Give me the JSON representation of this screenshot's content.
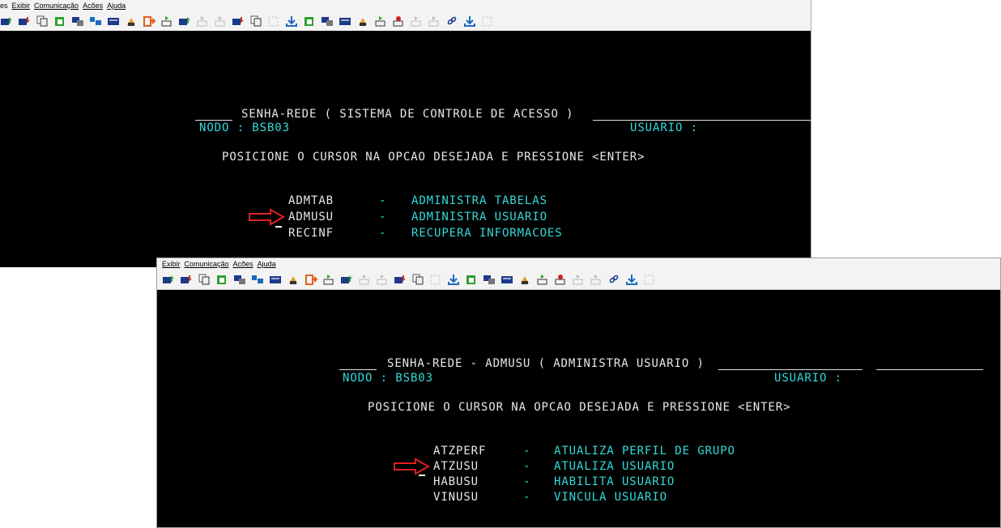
{
  "window1": {
    "menu": [
      "es",
      "Exibir",
      "Comunicação",
      "Acões",
      "Ajuda"
    ],
    "header": {
      "title": "SENHA-REDE ( SISTEMA DE CONTROLE DE ACESSO )",
      "nodo": "NODO : BSB03",
      "usuario": "USUARIO :",
      "instruction": "POSICIONE O CURSOR NA OPCAO DESEJADA E PRESSIONE <ENTER>"
    },
    "options": [
      {
        "code": "ADMTAB",
        "sep": "-",
        "desc": "ADMINISTRA TABELAS"
      },
      {
        "code": "ADMUSU",
        "sep": "-",
        "desc": "ADMINISTRA USUARIO"
      },
      {
        "code": "RECINF",
        "sep": "-",
        "desc": "RECUPERA INFORMACOES"
      }
    ]
  },
  "window2": {
    "menu": [
      "Exibir",
      "Comunicação",
      "Acões",
      "Ajuda"
    ],
    "header": {
      "title": "SENHA-REDE - ADMUSU ( ADMINISTRA USUARIO )",
      "nodo": "NODO : BSB03",
      "usuario": "USUARIO :",
      "instruction": "POSICIONE O CURSOR NA OPCAO DESEJADA E PRESSIONE <ENTER>"
    },
    "options": [
      {
        "code": "ATZPERF",
        "sep": "-",
        "desc": "ATUALIZA PERFIL DE GRUPO"
      },
      {
        "code": "ATZUSU",
        "sep": "-",
        "desc": "ATUALIZA USUARIO"
      },
      {
        "code": "HABUSU",
        "sep": "-",
        "desc": "HABILITA USUARIO"
      },
      {
        "code": "VINUSU",
        "sep": "-",
        "desc": "VINCULA USUARIO"
      }
    ]
  },
  "colors": {
    "terminal_bg": "#000000",
    "terminal_text": "#e8e8e8",
    "terminal_cyan": "#33dada",
    "arrow_red": "#e02020"
  },
  "toolbar_icons": [
    "send-icon",
    "receive-icon",
    "copy-icon",
    "paste-icon",
    "copy-table-icon",
    "window-icon",
    "keyboard-icon",
    "print-icon",
    "exit-icon",
    "macro-play-icon",
    "macro-send-icon",
    "macro-disabled-icon",
    "macro-disabled-icon",
    "receive-icon",
    "copy-icon",
    "refresh-icon",
    "download-icon",
    "paste-icon",
    "copy-table-icon",
    "keyboard-icon",
    "print-icon",
    "macro-play-icon",
    "macro-record-icon",
    "macro-disabled-icon",
    "macro-disabled-icon",
    "link-icon",
    "download-icon",
    "refresh-icon"
  ]
}
